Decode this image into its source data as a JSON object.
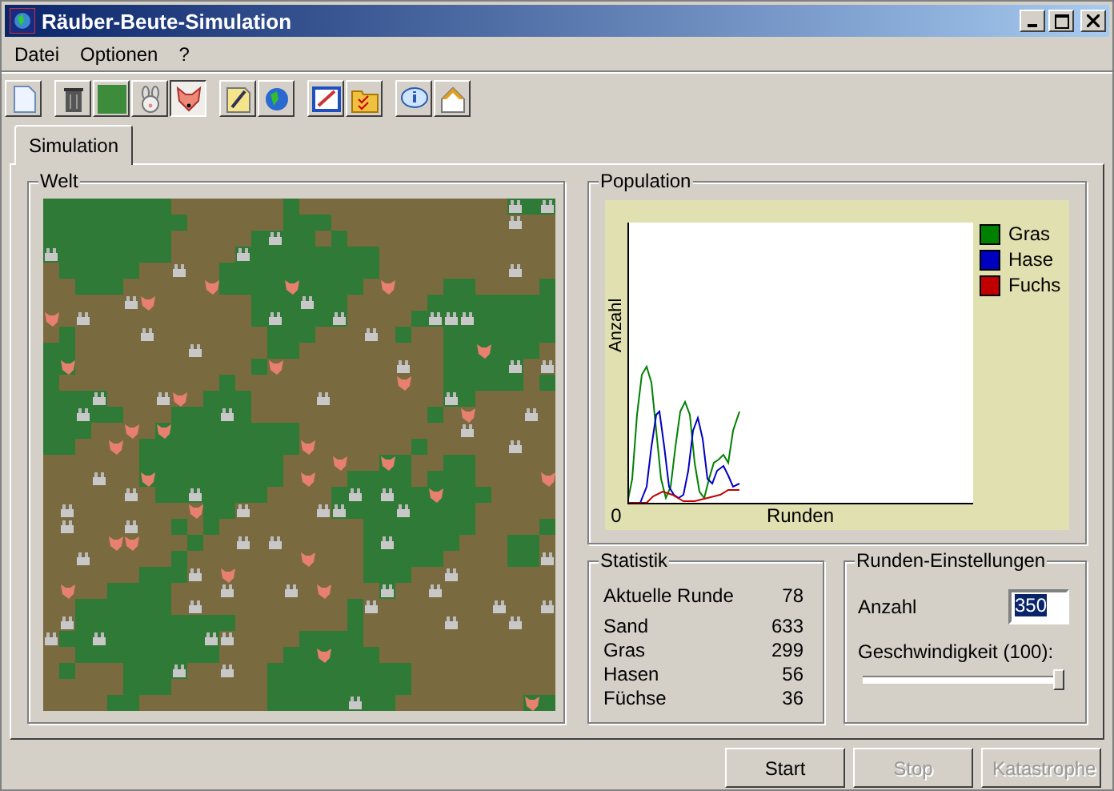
{
  "window": {
    "title": "Räuber-Beute-Simulation"
  },
  "menu": [
    "Datei",
    "Optionen",
    "?"
  ],
  "toolbar": [
    {
      "buttons": [
        {
          "selected": false
        }
      ]
    },
    {
      "buttons": [
        {
          "selected": false
        },
        {
          "selected": false
        },
        {
          "selected": false
        },
        {
          "selected": true
        }
      ]
    },
    {
      "buttons": [
        {
          "selected": false
        },
        {
          "selected": false
        }
      ]
    },
    {
      "buttons": [
        {
          "selected": false
        },
        {
          "selected": false
        }
      ]
    },
    {
      "buttons": [
        {
          "selected": false
        },
        {
          "selected": false
        }
      ]
    }
  ],
  "tabs": [
    {
      "label": "Simulation",
      "selected": true
    }
  ],
  "world": {
    "title": "Welt"
  },
  "population": {
    "title": "Population",
    "y_axis": "Anzahl",
    "x_axis": "Runden",
    "origin": "0",
    "legend": [
      {
        "label": "Gras",
        "color": "#008000"
      },
      {
        "label": "Hase",
        "color": "#0000c0"
      },
      {
        "label": "Fuchs",
        "color": "#c00000"
      }
    ]
  },
  "statistics": {
    "title": "Statistik",
    "rows": [
      {
        "label": "Aktuelle Runde",
        "value": "78"
      },
      {
        "label": "Sand",
        "value": "633"
      },
      {
        "label": "Gras",
        "value": "299"
      },
      {
        "label": "Hasen",
        "value": "56"
      },
      {
        "label": "Füchse",
        "value": "36"
      }
    ]
  },
  "round_settings": {
    "title": "Runden-Einstellungen",
    "count_label": "Anzahl",
    "count_value": "350",
    "speed": {
      "label": "Geschwindigkeit (100):",
      "level": 1
    }
  },
  "buttons": [
    {
      "label": "Start",
      "disabled": false
    },
    {
      "label": "Stop",
      "disabled": true
    },
    {
      "label": "Katastrophe",
      "disabled": true
    }
  ]
}
